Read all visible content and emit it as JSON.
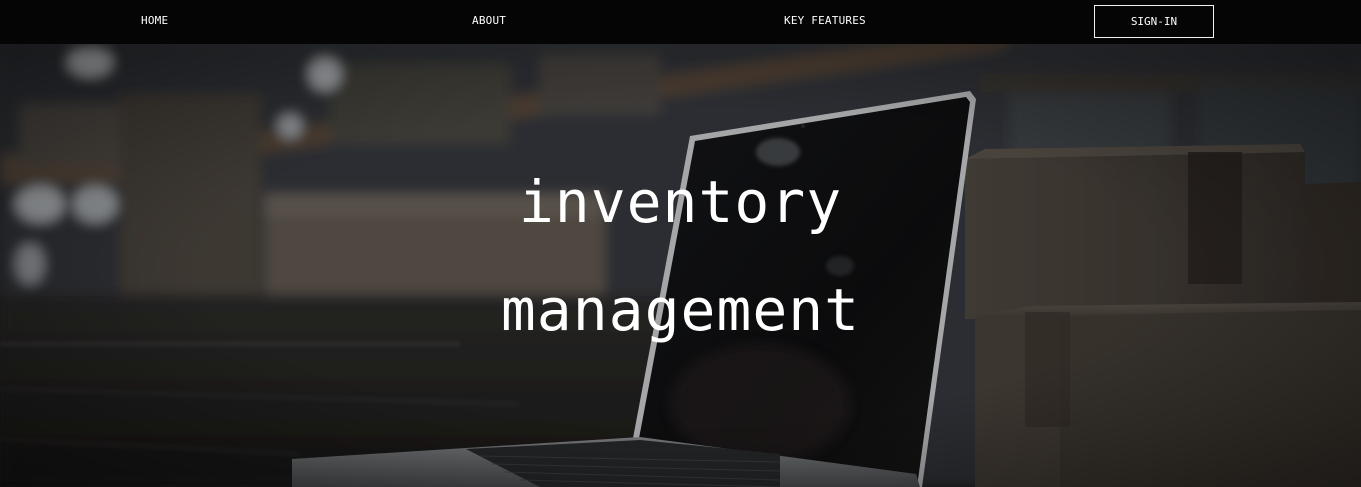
{
  "nav": {
    "items": [
      {
        "label": "HOME"
      },
      {
        "label": "ABOUT"
      },
      {
        "label": "KEY FEATURES"
      }
    ],
    "signin_label": "SIGN-IN"
  },
  "hero": {
    "title_line1": "inventory",
    "title_line2": "management",
    "background_description_icon": "warehouse-laptop-boxes-photo"
  },
  "colors": {
    "nav_background": "#050505",
    "text": "#ffffff",
    "signin_border": "#f2f2f2"
  }
}
